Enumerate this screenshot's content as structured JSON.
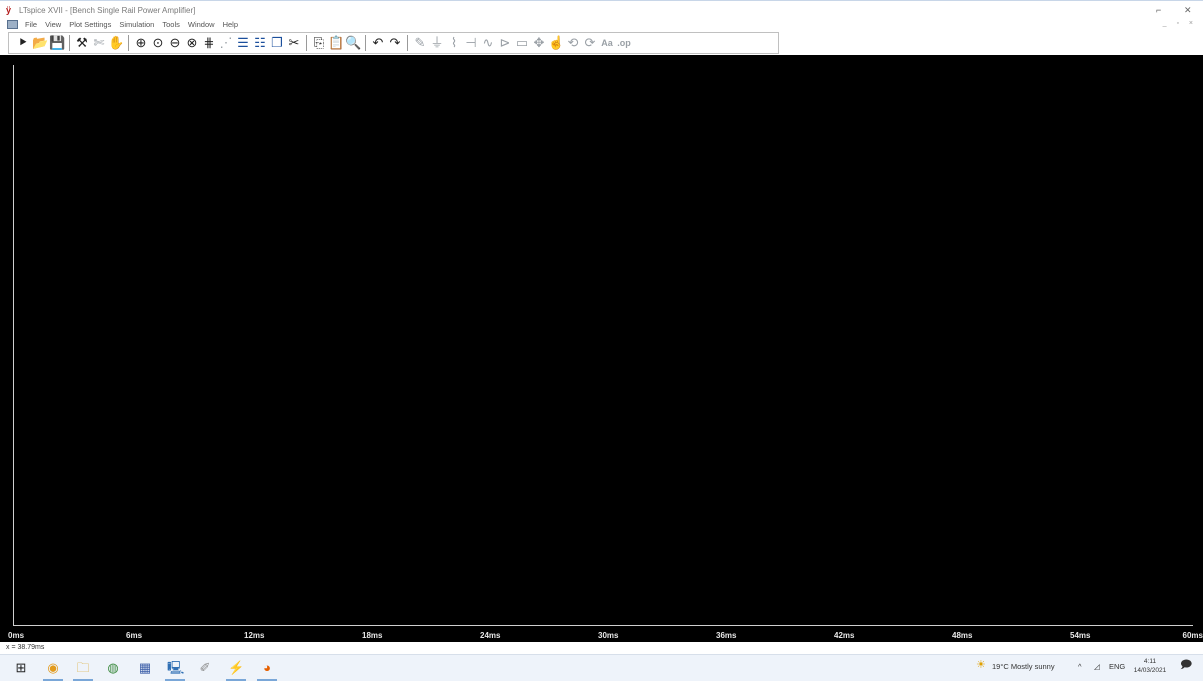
{
  "window": {
    "title": "LTspice XVII - [Bench Single Rail Power Amplifier]",
    "app_icon": "ltspice-icon",
    "controls": [
      "⌐",
      "✕"
    ]
  },
  "menubar": {
    "items": [
      "File",
      "View",
      "Plot Settings",
      "Simulation",
      "Tools",
      "Window",
      "Help"
    ],
    "mdi_controls": "_ ▫ ×"
  },
  "toolbar": {
    "icons": [
      {
        "name": "run-icon",
        "glyph": "⯈"
      },
      {
        "name": "open-icon",
        "glyph": "📂"
      },
      {
        "name": "save-icon",
        "glyph": "💾"
      },
      {
        "name": "control-panel-icon",
        "glyph": "⚒"
      },
      {
        "name": "halt-icon",
        "glyph": "✄"
      },
      {
        "name": "pan-icon",
        "glyph": "✋"
      },
      {
        "name": "zoom-in-icon",
        "glyph": "⊕"
      },
      {
        "name": "zoom-area-icon",
        "glyph": "⊙"
      },
      {
        "name": "zoom-out-icon",
        "glyph": "⊖"
      },
      {
        "name": "zoom-fit-icon",
        "glyph": "⊗"
      },
      {
        "name": "autorange-icon",
        "glyph": "⋕"
      },
      {
        "name": "pick-visible-traces-icon",
        "glyph": "⋰"
      },
      {
        "name": "tile-horizontal-icon",
        "glyph": "☰"
      },
      {
        "name": "tile-vertical-icon",
        "glyph": "☷"
      },
      {
        "name": "cascade-icon",
        "glyph": "❐"
      },
      {
        "name": "cut-icon",
        "glyph": "✂"
      },
      {
        "name": "copy-icon",
        "glyph": "⎘"
      },
      {
        "name": "paste-icon",
        "glyph": "📋"
      },
      {
        "name": "find-icon",
        "glyph": "🔍"
      },
      {
        "name": "undo-icon",
        "glyph": "↶"
      },
      {
        "name": "redo-icon",
        "glyph": "↷"
      },
      {
        "name": "wire-icon",
        "glyph": "✎"
      },
      {
        "name": "ground-icon",
        "glyph": "⏚"
      },
      {
        "name": "resistor-icon",
        "glyph": "⌇"
      },
      {
        "name": "capacitor-icon",
        "glyph": "⊣"
      },
      {
        "name": "inductor-icon",
        "glyph": "∿"
      },
      {
        "name": "diode-icon",
        "glyph": "⊳"
      },
      {
        "name": "component-icon",
        "glyph": "▭"
      },
      {
        "name": "move-icon",
        "glyph": "✥"
      },
      {
        "name": "drag-icon",
        "glyph": "☝"
      },
      {
        "name": "rotate-icon",
        "glyph": "⟲"
      },
      {
        "name": "mirror-icon",
        "glyph": "⟳"
      },
      {
        "name": "text-icon",
        "glyph": "Aa"
      },
      {
        "name": "spice-directive-icon",
        "glyph": ".op"
      }
    ]
  },
  "plot": {
    "x_ticks": [
      "0ms",
      "6ms",
      "12ms",
      "18ms",
      "24ms",
      "30ms",
      "36ms",
      "42ms",
      "48ms",
      "54ms",
      "60ms"
    ],
    "colors": {
      "background": "#000000",
      "axis": "#cfcfcf",
      "tick_text": "#e8e8e8"
    }
  },
  "chart_data": {
    "type": "line",
    "series": [],
    "x_tick_labels": [
      "0ms",
      "6ms",
      "12ms",
      "18ms",
      "24ms",
      "30ms",
      "36ms",
      "42ms",
      "48ms",
      "54ms",
      "60ms"
    ],
    "xlim": [
      0,
      60
    ],
    "grid": false
  },
  "status": {
    "text": "x = 38.79ms"
  },
  "taskbar": {
    "apps": [
      {
        "name": "start-icon",
        "glyph": "⊞",
        "active": false
      },
      {
        "name": "chrome-canary-icon",
        "glyph": "◉",
        "active": true
      },
      {
        "name": "file-explorer-icon",
        "glyph": "🗀",
        "active": true
      },
      {
        "name": "chrome-icon",
        "glyph": "◍",
        "active": false
      },
      {
        "name": "calculator-icon",
        "glyph": "▦",
        "active": false
      },
      {
        "name": "remote-desktop-icon",
        "glyph": "🖳",
        "active": true
      },
      {
        "name": "tool-icon",
        "glyph": "✐",
        "active": false
      },
      {
        "name": "ltspice-icon",
        "glyph": "⚡",
        "active": true
      },
      {
        "name": "firefox-icon",
        "glyph": "◕",
        "active": true
      }
    ],
    "weather": "19°C  Mostly sunny",
    "language": "ENG",
    "clock_time": "4:11",
    "clock_date": "14/03/2021"
  }
}
